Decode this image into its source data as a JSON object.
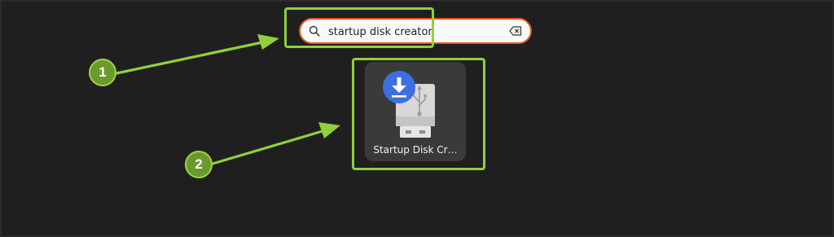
{
  "search": {
    "query": "startup disk creator",
    "icon": "search-icon",
    "clear_icon": "backspace-clear-icon"
  },
  "results": [
    {
      "label": "Startup Disk Cr…",
      "icon": "usb-download-icon"
    }
  ],
  "annotations": [
    {
      "number": "1",
      "target": "search field"
    },
    {
      "number": "2",
      "target": "Startup Disk Creator result"
    }
  ],
  "colors": {
    "background": "#1f1f1f",
    "search_border": "#e95420",
    "highlight": "#8fd13a",
    "badge": "#6a9a2c",
    "tile": "#3a3a3a",
    "download_badge": "#3d6fe0"
  }
}
